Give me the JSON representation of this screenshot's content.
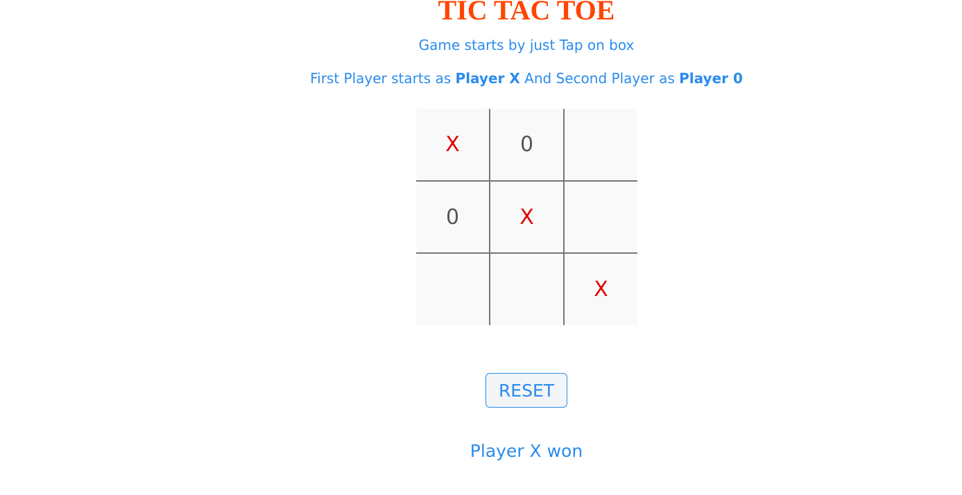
{
  "title": "TIC TAC TOE",
  "subtitle": "Game starts by just Tap on box",
  "instructions": {
    "prefix": "First Player starts as ",
    "player_x": "Player X",
    "middle": " And Second Player as ",
    "player_o": "Player 0"
  },
  "board": {
    "cells": [
      "X",
      "0",
      "",
      "0",
      "X",
      "",
      "",
      "",
      "X"
    ]
  },
  "reset_label": "RESET",
  "status": "Player X won",
  "colors": {
    "title": "#ff4500",
    "text": "#2a8ceb",
    "x_mark": "#e00000",
    "o_mark": "#555555",
    "cell_bg": "#f9f9f9",
    "grid_line": "#777777"
  }
}
